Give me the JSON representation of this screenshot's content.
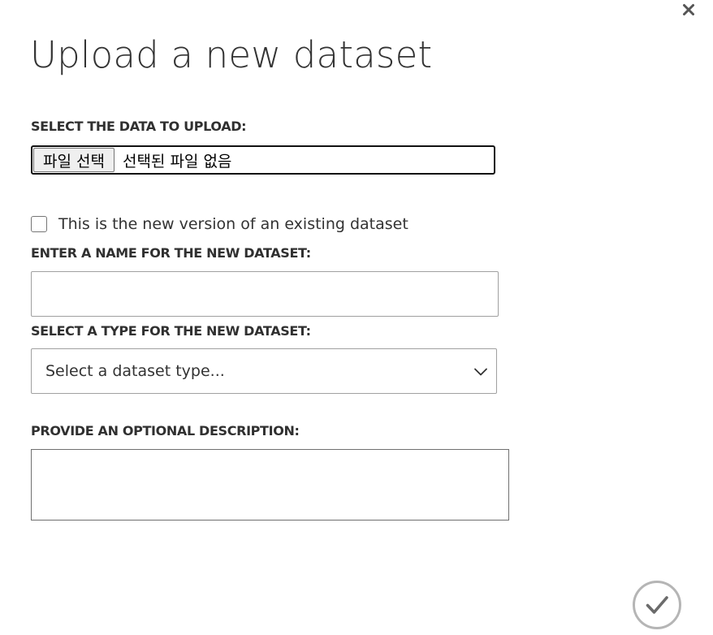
{
  "dialog": {
    "title": "Upload a new dataset",
    "close_icon": "close-icon",
    "ok_icon": "checkmark-icon"
  },
  "upload": {
    "label": "SELECT THE DATA TO UPLOAD:",
    "button_label": "파일 선택",
    "status_text": "선택된 파일 없음"
  },
  "version": {
    "checked": false,
    "label": "This is the new version of an existing dataset"
  },
  "name": {
    "label": "ENTER A NAME FOR THE NEW DATASET:",
    "value": ""
  },
  "type": {
    "label": "SELECT A TYPE FOR THE NEW DATASET:",
    "selected": "Select a dataset type...",
    "chevron_icon": "chevron-down-icon"
  },
  "description": {
    "label": "PROVIDE AN OPTIONAL DESCRIPTION:",
    "value": ""
  },
  "colors": {
    "text": "#333333",
    "border": "#a0a0a0",
    "focus_border": "#111111",
    "icon_gray": "#777777"
  }
}
